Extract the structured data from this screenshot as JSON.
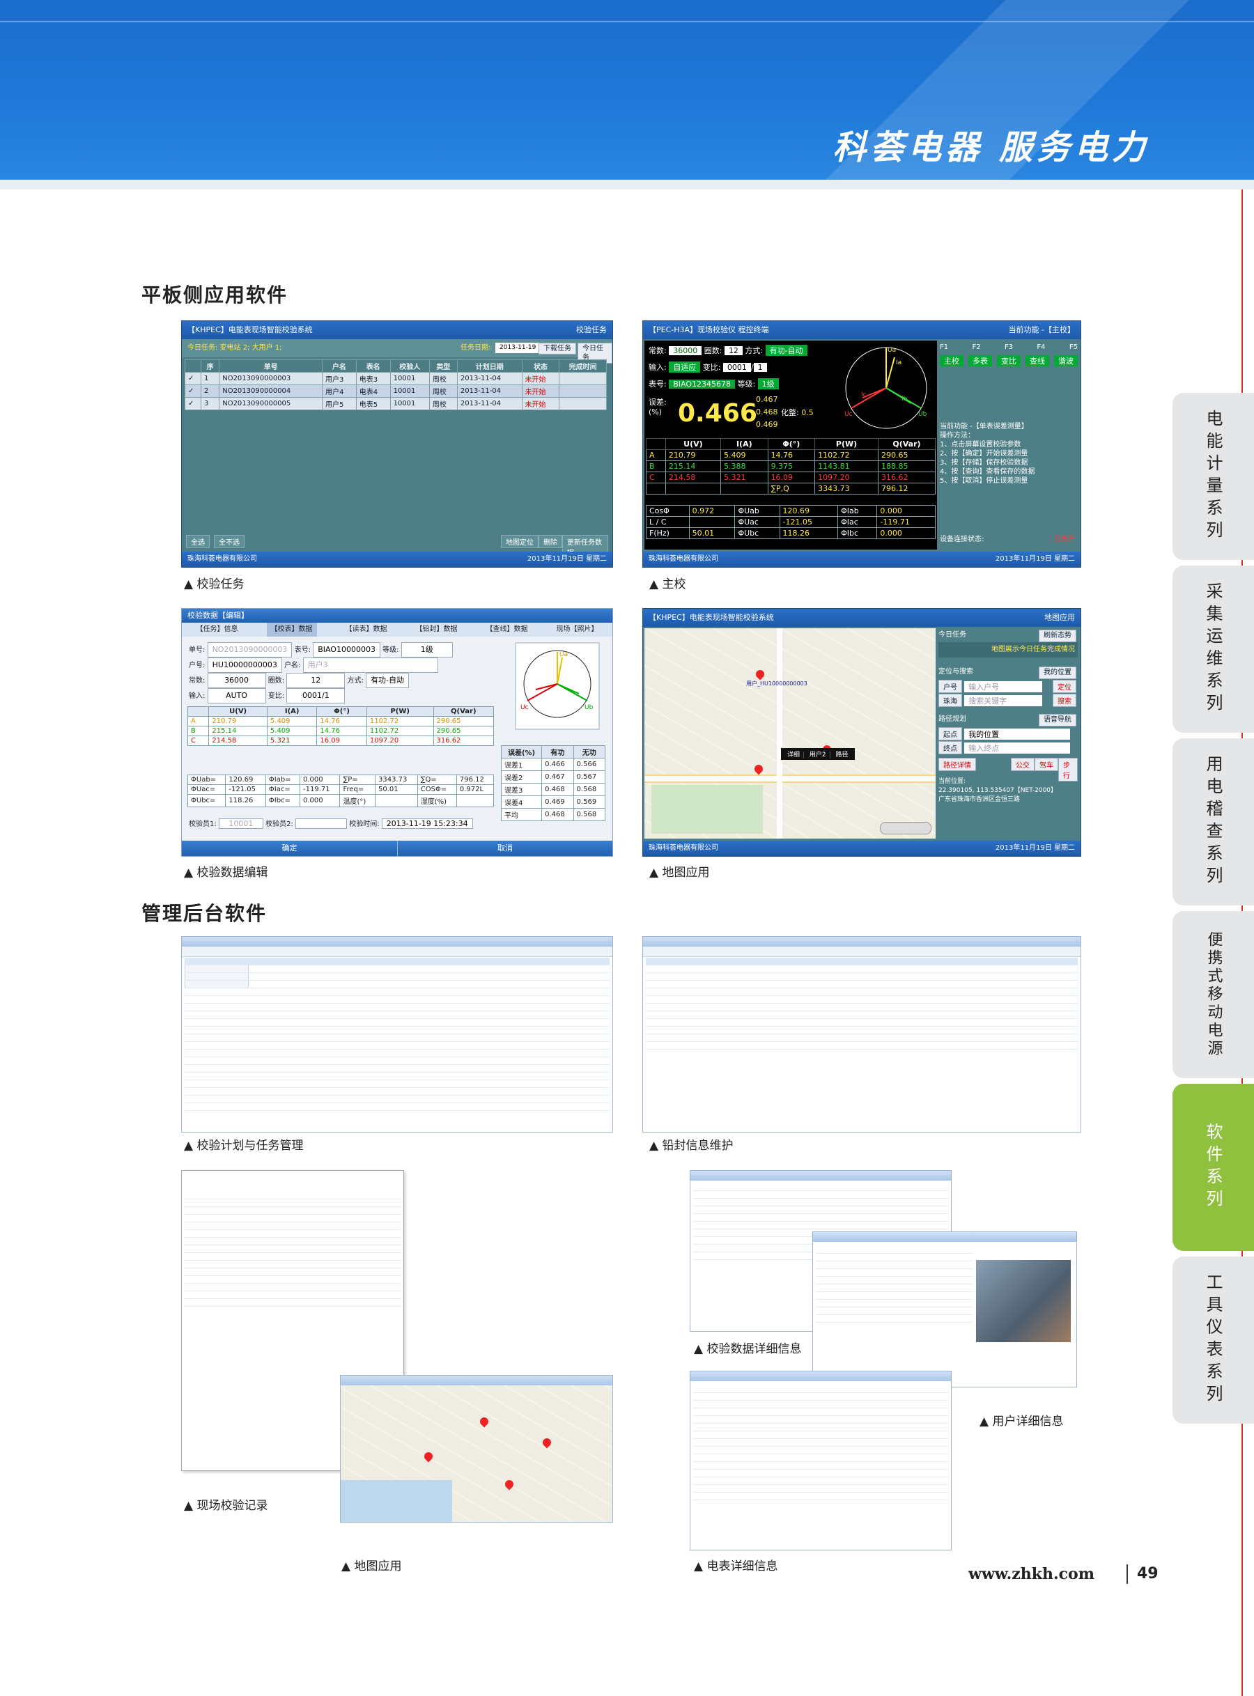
{
  "header": {
    "slogan": "科荟电器  服务电力"
  },
  "sections": {
    "tablet": "平板侧应用软件",
    "backend": "管理后台软件"
  },
  "side_tabs": [
    {
      "label": "电能计量系列",
      "active": false
    },
    {
      "label": "采集运维系列",
      "active": false
    },
    {
      "label": "用电稽查系列",
      "active": false
    },
    {
      "label": "便携式移动电源",
      "active": false
    },
    {
      "label": "软件系列",
      "active": true
    },
    {
      "label": "工具仪表系列",
      "active": false
    }
  ],
  "captions": {
    "s1": "校验任务",
    "s2": "主校",
    "s3": "校验数据编辑",
    "s4": "地图应用",
    "b1": "校验计划与任务管理",
    "b2": "铅封信息维护",
    "b3": "现场校验记录",
    "b4": "校验数据详细信息",
    "b5": "用户详细信息",
    "b6": "地图应用",
    "b7": "电表详细信息"
  },
  "screen1": {
    "title": "【KHPEC】电能表现场智能校验系统",
    "title_right": "校验任务",
    "today": "今日任务: 变电站 2; 大用户 1;",
    "date_label": "任务日期:",
    "date": "2013-11-19",
    "btn_download": "下载任务",
    "btn_today": "今日任务",
    "columns": [
      "序",
      "单号",
      "户名",
      "表名",
      "校验人",
      "类型",
      "计划日期",
      "状态",
      "完成时间"
    ],
    "rows": [
      [
        "1",
        "NO2013090000003",
        "用户3",
        "电表3",
        "10001",
        "周校",
        "2013-11-04",
        "未开始",
        ""
      ],
      [
        "2",
        "NO2013090000004",
        "用户4",
        "电表4",
        "10001",
        "周校",
        "2013-11-04",
        "未开始",
        ""
      ],
      [
        "3",
        "NO2013090000005",
        "用户5",
        "电表5",
        "10001",
        "周校",
        "2013-11-04",
        "未开始",
        ""
      ]
    ],
    "btn_all": "全选",
    "btn_none": "全不选",
    "btn_map": "地图定位",
    "btn_del": "删除",
    "btn_update": "更新任务数据",
    "footer_left": "珠海科荟电器有限公司",
    "footer_right": "2013年11月19日 星期二"
  },
  "screen2": {
    "title": "【PEC-H3A】现场校验仪 程控终端",
    "title_right": "当前功能 -【主校】",
    "const_label": "常数:",
    "const": "36000",
    "laps_label": "圈数:",
    "laps": "12",
    "mode_label": "方式:",
    "mode": "有功-自动",
    "input_label": "输入:",
    "input": "自适应",
    "ratio_label": "变比:",
    "ratio_a": "0001",
    "ratio_b": "1",
    "meter_label": "表号:",
    "meter": "BIAO12345678",
    "grade_label": "等级:",
    "grade": "1级",
    "err_label": "误差:",
    "err_unit": "(%)",
    "err_main": "0.466",
    "err_1": "0.467",
    "err_2": "0.468",
    "err_3": "0.469",
    "pf_label": "化整:",
    "pf": "0.5",
    "headers": [
      "",
      "U(V)",
      "I(A)",
      "Φ(°)",
      "P(W)",
      "Q(Var)"
    ],
    "rows": [
      [
        "A",
        "210.79",
        "5.409",
        "14.76",
        "1102.72",
        "290.65"
      ],
      [
        "B",
        "215.14",
        "5.388",
        "9.375",
        "1143.81",
        "188.85"
      ],
      [
        "C",
        "214.58",
        "5.321",
        "16.09",
        "1097.20",
        "316.62"
      ]
    ],
    "sum_label": "∑P,Q",
    "sum_p": "3343.73",
    "sum_q": "796.12",
    "bottom": [
      [
        "CosΦ",
        "0.972",
        "ΦUab",
        "120.69",
        "ΦIab",
        "0.000"
      ],
      [
        "L / C",
        "",
        "ΦUac",
        "-121.05",
        "ΦIac",
        "-119.71"
      ],
      [
        "F(Hz)",
        "50.01",
        "ΦUbc",
        "118.26",
        "ΦIbc",
        "0.000"
      ]
    ],
    "fkeys": [
      "F1",
      "F2",
      "F3",
      "F4",
      "F5"
    ],
    "func_keys": [
      "主校",
      "多表",
      "变比",
      "查线",
      "谐波"
    ],
    "help_title": "当前功能 -【单表误差测量】",
    "help_sub": "操作方法：",
    "help_lines": [
      "1、点击屏幕设置校验参数",
      "2、按【确定】开始误差测量",
      "3、按【存储】保存校验数据",
      "4、按【查询】查看保存的数据",
      "5、按【取消】停止误差测量"
    ],
    "status_label": "设备连接状态:",
    "status": "已断开",
    "vec": [
      "Ua",
      "Ia",
      "Ib",
      "Ic",
      "Ub",
      "Uc"
    ],
    "footer_left": "珠海科荟电器有限公司",
    "footer_right": "2013年11月19日 星期二"
  },
  "screen3": {
    "title": "校验数据【编辑】",
    "tabs": [
      "【任务】信息",
      "【校表】数据",
      "【读表】数据",
      "【铅封】数据",
      "【查线】数据",
      "现场【照片】"
    ],
    "f_no_label": "单号:",
    "f_no": "NO2013090000003",
    "f_meter_label": "表号:",
    "f_meter": "BIAO10000003",
    "f_grade_label": "等级:",
    "f_grade": "1级",
    "f_user_label": "户号:",
    "f_user": "HU10000000003",
    "f_name_label": "户名:",
    "f_name": "用户3",
    "f_const_label": "常数:",
    "f_const": "36000",
    "f_laps_label": "圈数:",
    "f_laps": "12",
    "f_mode_label": "方式:",
    "f_mode": "有功-自动",
    "f_input_label": "输入:",
    "f_input": "AUTO",
    "f_ratio_label": "变比:",
    "f_ratio": "0001/1",
    "headers": [
      "",
      "U(V)",
      "I(A)",
      "Φ(°)",
      "P(W)",
      "Q(Var)"
    ],
    "rows": [
      [
        "A",
        "210.79",
        "5.409",
        "14.76",
        "1102.72",
        "290.65"
      ],
      [
        "B",
        "215.14",
        "5.409",
        "14.76",
        "1102.72",
        "290.65"
      ],
      [
        "C",
        "214.58",
        "5.321",
        "16.09",
        "1097.20",
        "316.62"
      ]
    ],
    "err_header": [
      "误差(%)",
      "有功",
      "无功"
    ],
    "err_rows": [
      [
        "误差1",
        "0.466",
        "0.566"
      ],
      [
        "误差2",
        "0.467",
        "0.567"
      ],
      [
        "误差3",
        "0.468",
        "0.568"
      ],
      [
        "误差4",
        "0.469",
        "0.569"
      ],
      [
        "平均",
        "0.468",
        "0.568"
      ]
    ],
    "phi_rows": [
      [
        "ΦUab=",
        "120.69",
        "ΦIab=",
        "0.000",
        "∑P=",
        "3343.73",
        "∑Q=",
        "796.12"
      ],
      [
        "ΦUac=",
        "-121.05",
        "ΦIac=",
        "-119.71",
        "Freq=",
        "50.01",
        "COSΦ=",
        "0.972L"
      ],
      [
        "ΦUbc=",
        "118.26",
        "ΦIbc=",
        "0.000",
        "温度(°)",
        "",
        "湿度(%)",
        ""
      ]
    ],
    "inspector1_label": "校验员1:",
    "inspector1": "10001",
    "inspector2_label": "校验员2:",
    "time_label": "校验时间:",
    "time": "2013-11-19 15:23:34",
    "btn_ok": "确定",
    "btn_cancel": "取消",
    "vec": [
      "Ua",
      "Uc",
      "Ub"
    ]
  },
  "screen4": {
    "title": "【KHPEC】电能表现场智能校验系统",
    "title_right": "地图应用",
    "today_label": "今日任务",
    "today_btn": "刷新态势",
    "today_note": "地图展示今日任务完成情况",
    "search_label": "定位与搜索",
    "my_pos_btn": "我的位置",
    "user_label": "户号",
    "user_ph": "输入户号",
    "locate_btn": "定位",
    "area_label": "珠海",
    "area_ph": "搜索关键字",
    "search_btn": "搜索",
    "route_label": "路径规划",
    "voice_btn": "语音导航",
    "start_label": "起点",
    "start_val": "我的位置",
    "end_label": "终点",
    "end_ph": "输入终点",
    "route_btns": [
      "路径详情",
      "公交",
      "驾车",
      "步行"
    ],
    "pos_title": "当前位置:",
    "pos_coords": "22.390105, 113.535407【NET-2000】",
    "pos_addr": "广东省珠海市香洲区金恒三路",
    "popup": [
      "详细",
      "用户2",
      "路径"
    ],
    "pin_label": "用户_HU10000000003",
    "footer_left": "珠海科荟电器有限公司",
    "footer_right": "2013年11月19日 星期二"
  },
  "footer": {
    "url": "www.zhkh.com",
    "page": "49"
  }
}
